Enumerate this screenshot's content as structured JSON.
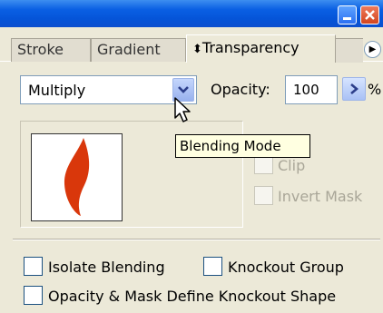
{
  "window": {
    "minimize_icon": "minimize-icon",
    "close_icon": "close-icon"
  },
  "tabs": [
    {
      "label": "Stroke",
      "active": false
    },
    {
      "label": "Gradient",
      "active": false
    },
    {
      "label": "Transparency",
      "active": true,
      "icon": "updown-arrows-icon"
    }
  ],
  "blend_mode": {
    "value": "Multiply",
    "dropdown_icon": "chevron-down-icon",
    "tooltip": "Blending Mode"
  },
  "opacity": {
    "label": "Opacity:",
    "value": "100",
    "unit": "%",
    "stepper_icon": "chevron-right-icon"
  },
  "mask": {
    "clip_label": "Clip",
    "invert_mask_label": "Invert Mask"
  },
  "options": {
    "isolate_blending": "Isolate Blending",
    "knockout_group": "Knockout Group",
    "opacity_mask_knockout": "Opacity & Mask Define Knockout Shape"
  },
  "colors": {
    "title_bar": "#0a5fe3",
    "panel_bg": "#ece9d8",
    "thumbnail_shape": "#d9370b",
    "tooltip_bg": "#ffffe1"
  }
}
